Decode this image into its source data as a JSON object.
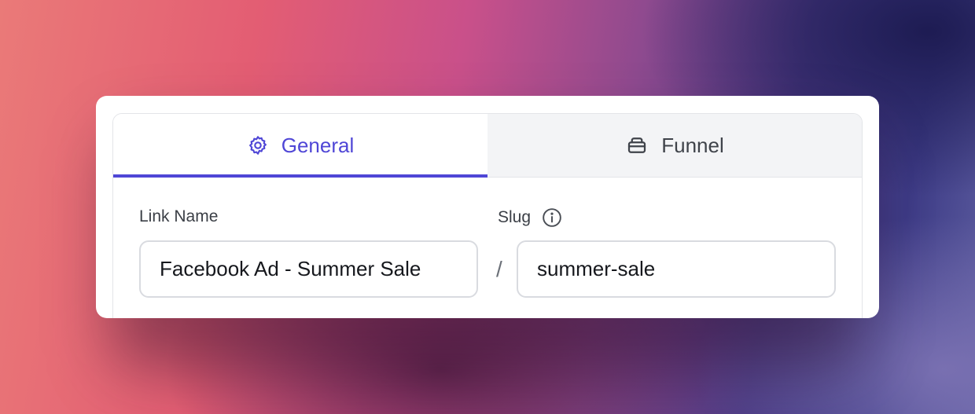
{
  "tabs": [
    {
      "label": "General",
      "icon": "gear-icon",
      "active": true
    },
    {
      "label": "Funnel",
      "icon": "funnel-icon",
      "active": false
    }
  ],
  "form": {
    "link_name": {
      "label": "Link Name",
      "value": "Facebook Ad - Summer Sale"
    },
    "separator": "/",
    "slug": {
      "label": "Slug",
      "value": "summer-sale",
      "info_icon": "info-icon"
    }
  },
  "colors": {
    "accent": "#4f46d6",
    "inactive_tab_bg": "#f3f4f6",
    "border": "#d9dbe0"
  }
}
